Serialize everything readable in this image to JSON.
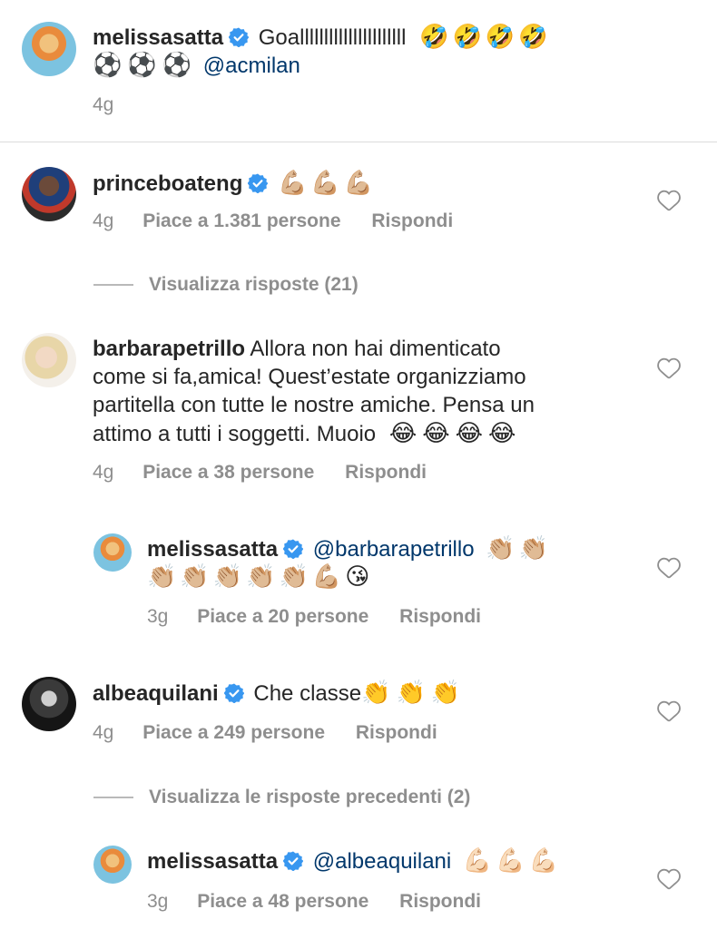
{
  "caption": {
    "username": "melissasatta",
    "text": "Goallllllllllllllllllllll",
    "emojis_line1": "🤣🤣🤣🤣",
    "emojis_line2": "⚽⚽⚽",
    "mention": "@acmilan",
    "time": "4g"
  },
  "comments": [
    {
      "username": "princeboateng",
      "verified": true,
      "emojis": "💪🏼💪🏼💪🏼",
      "time": "4g",
      "likes": "Piace a 1.381 persone",
      "reply": "Rispondi",
      "view_replies": "Visualizza risposte (21)"
    },
    {
      "username": "barbarapetrillo",
      "verified": false,
      "line1": "Allora non hai dimenticato",
      "line2": "come si fa,amica! Quest’estate organizziamo",
      "line3": "partitella con tutte le nostre amiche. Pensa un",
      "line4": "attimo a tutti i soggetti. Muoio",
      "emojis": "😂😂😂😂",
      "time": "4g",
      "likes": "Piace a 38 persone",
      "reply": "Rispondi"
    },
    {
      "username": "melissasatta",
      "verified": true,
      "mention": "@barbarapetrillo",
      "emojis_line1": "👏🏼👏🏼",
      "emojis_line2": "👏🏼👏🏼👏🏼👏🏼👏🏼💪🏼😘",
      "time": "3g",
      "likes": "Piace a 20 persone",
      "reply": "Rispondi"
    },
    {
      "username": "albeaquilani",
      "verified": true,
      "text": "Che classe",
      "emojis": "👏👏👏",
      "time": "4g",
      "likes": "Piace a 249 persone",
      "reply": "Rispondi",
      "view_replies": "Visualizza le risposte precedenti (2)"
    },
    {
      "username": "melissasatta",
      "verified": true,
      "mention": "@albeaquilani",
      "emojis": "💪🏻💪🏻💪🏻",
      "time": "3g",
      "likes": "Piace a 48 persone",
      "reply": "Rispondi"
    }
  ],
  "colors": {
    "verified_blue": "#3897f0",
    "mention_blue": "#00376b",
    "meta_gray": "#8e8e8e"
  },
  "icons": {
    "verified": "verified-badge-icon",
    "like": "heart-outline-icon"
  }
}
